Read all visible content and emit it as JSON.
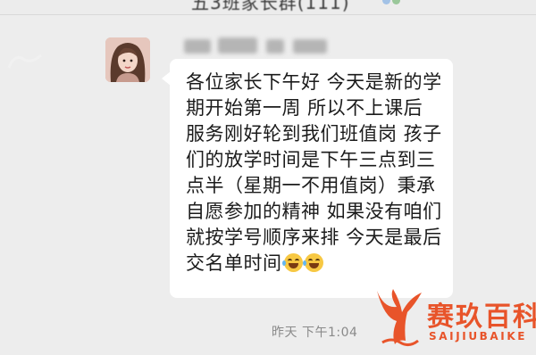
{
  "chat": {
    "title_partial": "五3班家长群(111)",
    "sender_name_redacted": true
  },
  "message": {
    "lines": [
      "各位家长下午好 今天是新的学",
      "期开始第一周  所以不上课后",
      "服务刚好轮到我们班值岗 孩子",
      "们的放学时间是下午三点到三",
      "点半（星期一不用值岗）秉承",
      "自愿参加的精神 如果没有咱们",
      "就按学号顺序来排 今天是最后",
      "交名单时间"
    ],
    "emojis": [
      "grinning-sweat-emoji",
      "grinning-sweat-emoji"
    ],
    "timestamp": "昨天 下午1:04"
  },
  "brand": {
    "name": "赛玖百科",
    "subtitle": "SAIJIUBAIKE",
    "color": "#e8542a"
  },
  "colors": {
    "background": "#ededed",
    "bubble": "#ffffff",
    "text": "#1b1b1b",
    "timestamp": "#8a8a8a"
  }
}
